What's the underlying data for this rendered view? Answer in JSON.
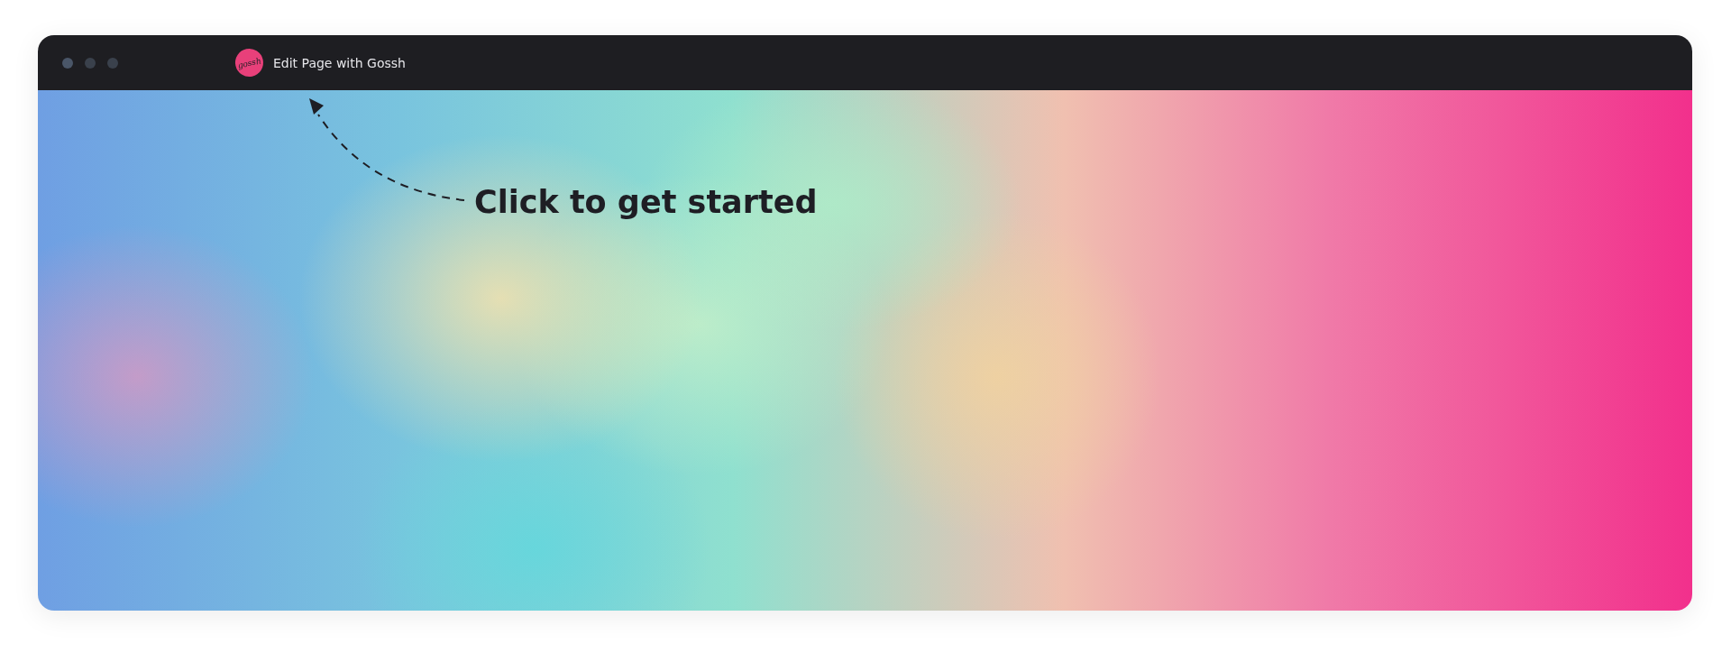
{
  "window": {
    "title": "Edit Page with Gossh",
    "logo": "gossh"
  },
  "content": {
    "hint": "Click to get started"
  }
}
